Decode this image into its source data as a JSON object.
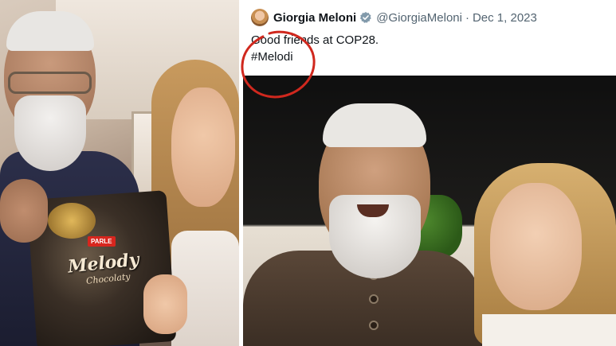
{
  "tweet": {
    "display_name": "Giorgia Meloni",
    "handle": "@GiorgiaMeloni",
    "separator": "·",
    "date": "Dec 1, 2023",
    "text_line1": "Good friends at COP28.",
    "text_line2": "#Melodi"
  },
  "left_photo": {
    "bag_brand": "PARLE",
    "bag_name": "Melody",
    "bag_subtitle": "Chocolaty"
  },
  "icons": {
    "verified": "verified-badge-icon"
  },
  "colors": {
    "verified_badge": "#829aab",
    "annotation": "#d0281e",
    "text_primary": "#0f1419",
    "text_secondary": "#536471"
  }
}
